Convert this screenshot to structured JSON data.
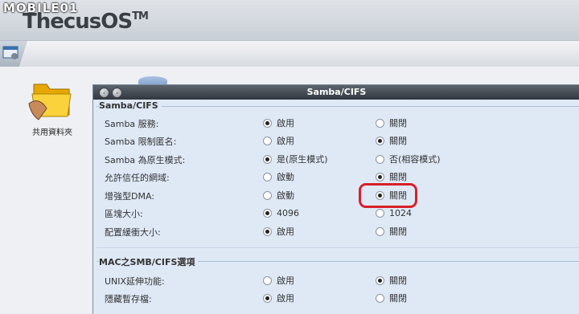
{
  "watermark": "MOBILE01",
  "app": {
    "logo": "ThecusOS",
    "tm": "TM"
  },
  "desktop": {
    "shared_folders_label": "共用資料夾"
  },
  "window": {
    "title": "Samba/CIFS"
  },
  "sections": [
    {
      "title": "Samba/CIFS",
      "rows": [
        {
          "label": "Samba 服務:",
          "opt1": "啟用",
          "opt2": "關閉",
          "selected": 1
        },
        {
          "label": "Samba 限制匿名:",
          "opt1": "啟用",
          "opt2": "關閉",
          "selected": 2
        },
        {
          "label": "Samba 為原生模式:",
          "opt1": "是(原生模式)",
          "opt2": "否(相容模式)",
          "selected": 1
        },
        {
          "label": "允許信任的網域:",
          "opt1": "啟動",
          "opt2": "關閉",
          "selected": 2
        },
        {
          "label": "增強型DMA:",
          "opt1": "啟動",
          "opt2": "關閉",
          "selected": 2
        },
        {
          "label": "區塊大小:",
          "opt1": "4096",
          "opt2": "1024",
          "selected": 1
        },
        {
          "label": "配置緩衝大小:",
          "opt1": "啟用",
          "opt2": "關閉",
          "selected": 1
        }
      ]
    },
    {
      "title": "MAC之SMB/CIFS選項",
      "rows": [
        {
          "label": "UNIX延伸功能:",
          "opt1": "啟用",
          "opt2": "關閉",
          "selected": 2
        },
        {
          "label": "隱藏暫存檔:",
          "opt1": "啟用",
          "opt2": "關閉",
          "selected": 1
        }
      ]
    }
  ],
  "colors": {
    "highlight": "#d8202a",
    "titlebar": "#3a4048",
    "panel": "#dfe9f6"
  },
  "icons": {
    "back": "back-arrow-icon",
    "forward": "forward-arrow-icon",
    "folder": "shared-folder-icon",
    "tool": "network-settings-icon"
  }
}
